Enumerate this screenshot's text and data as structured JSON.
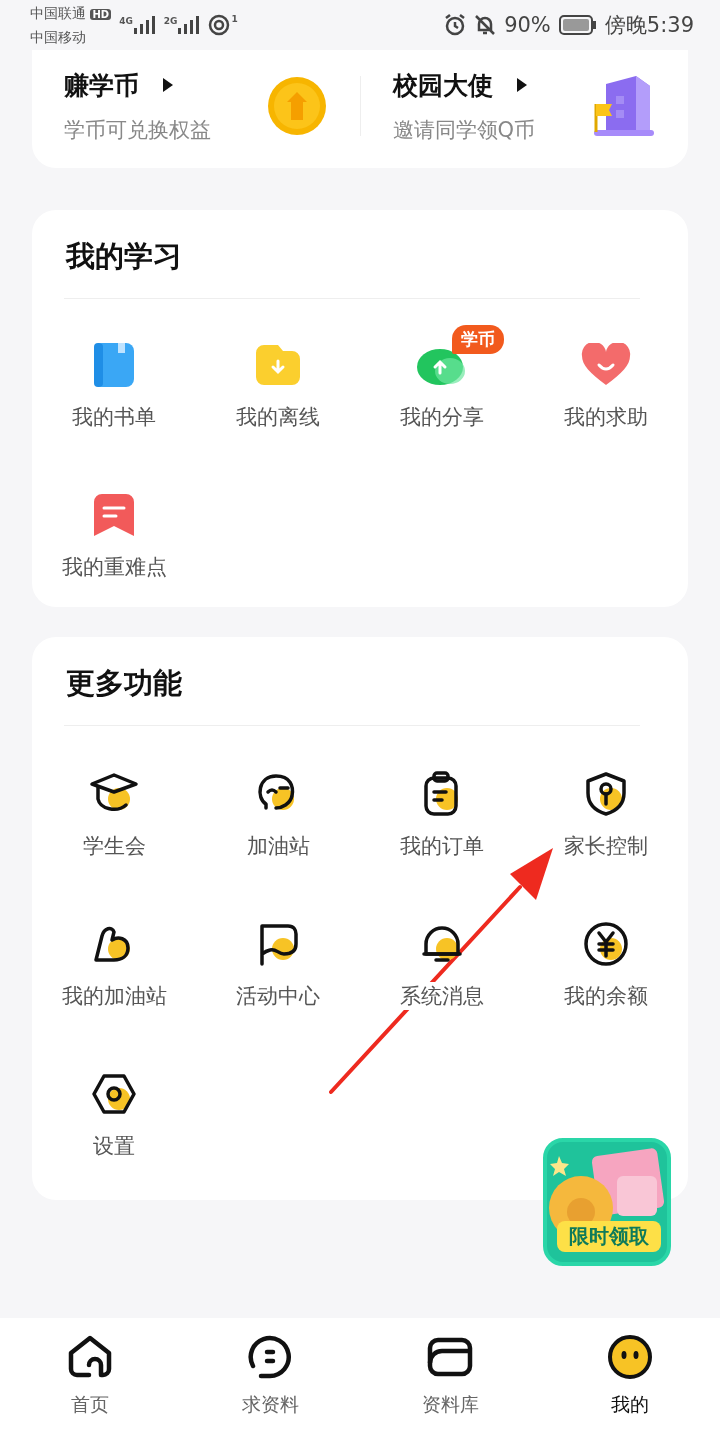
{
  "status_bar": {
    "carrier_1": "中国联通",
    "hd_badge": "HD",
    "network_1": "4G",
    "carrier_2": "中国移动",
    "network_2": "2G",
    "hotspot_count": "1",
    "battery": "90%",
    "time": "傍晚5:39"
  },
  "promos": [
    {
      "title": "赚学币",
      "subtitle": "学币可兑换权益"
    },
    {
      "title": "校园大使",
      "subtitle": "邀请同学领Q币"
    }
  ],
  "sections": [
    {
      "title": "我的学习",
      "items": [
        {
          "label": "我的书单"
        },
        {
          "label": "我的离线"
        },
        {
          "label": "我的分享",
          "badge": "学币"
        },
        {
          "label": "我的求助"
        },
        {
          "label": "我的重难点"
        }
      ]
    },
    {
      "title": "更多功能",
      "items": [
        {
          "label": "学生会"
        },
        {
          "label": "加油站"
        },
        {
          "label": "我的订单"
        },
        {
          "label": "家长控制"
        },
        {
          "label": "我的加油站"
        },
        {
          "label": "活动中心"
        },
        {
          "label": "系统消息"
        },
        {
          "label": "我的余额"
        },
        {
          "label": "设置"
        }
      ]
    }
  ],
  "floating_promo": {
    "label": "限时领取"
  },
  "annotation": {
    "kind": "arrow"
  },
  "tabs": [
    {
      "label": "首页",
      "selected": false
    },
    {
      "label": "求资料",
      "selected": false
    },
    {
      "label": "资料库",
      "selected": false
    },
    {
      "label": "我的",
      "selected": true
    }
  ]
}
